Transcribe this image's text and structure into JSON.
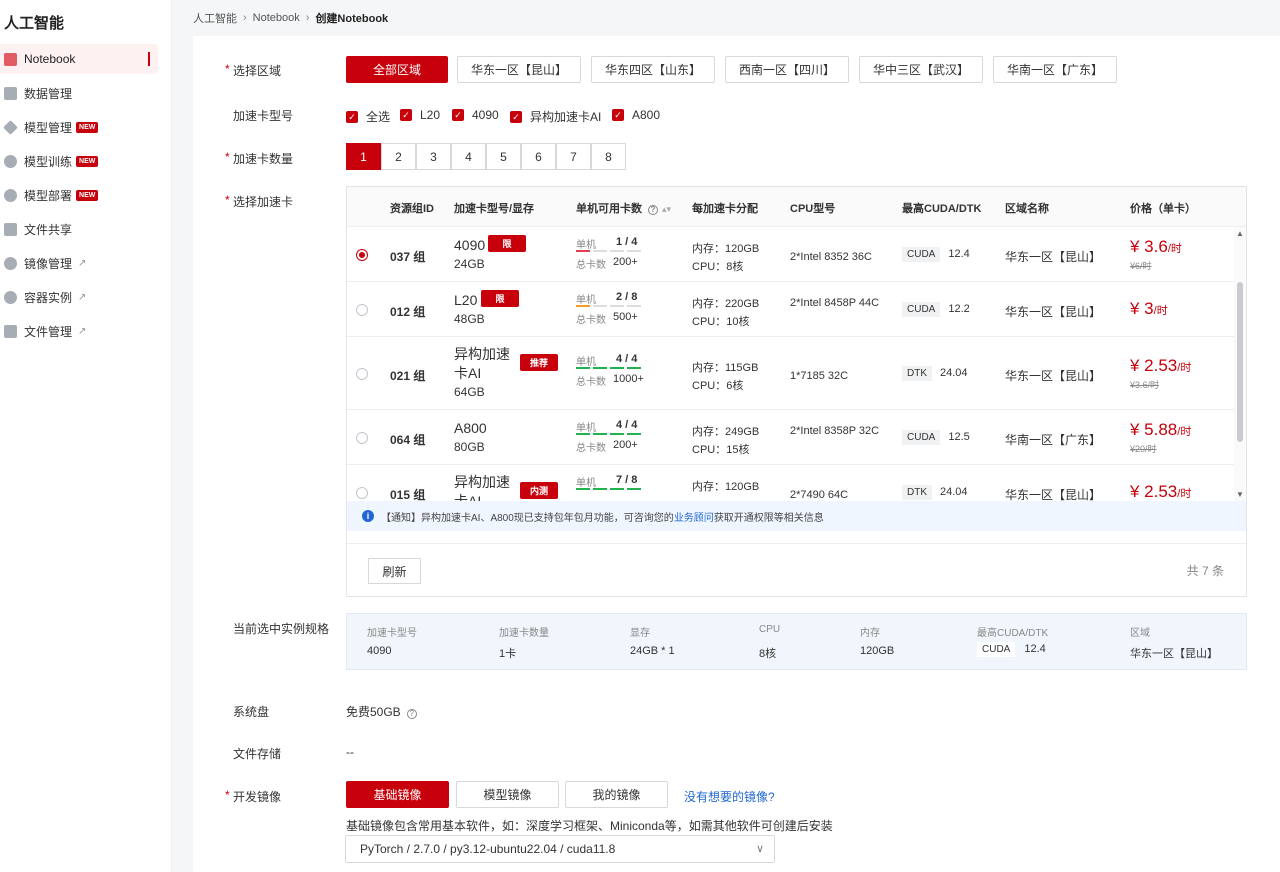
{
  "sidebar": {
    "title": "人工智能",
    "items": [
      {
        "label": "Notebook",
        "active": true,
        "icon": "notebook-icon"
      },
      {
        "label": "数据管理",
        "icon": "database-icon"
      },
      {
        "label": "模型管理",
        "badge": "NEW",
        "icon": "model-icon"
      },
      {
        "label": "模型训练",
        "badge": "NEW",
        "icon": "training-icon"
      },
      {
        "label": "模型部署",
        "badge": "NEW",
        "icon": "deploy-icon"
      },
      {
        "label": "文件共享",
        "icon": "file-share-icon"
      },
      {
        "label": "镜像管理",
        "external": true,
        "icon": "image-icon"
      },
      {
        "label": "容器实例",
        "external": true,
        "icon": "container-icon"
      },
      {
        "label": "文件管理",
        "external": true,
        "icon": "folder-icon"
      }
    ]
  },
  "breadcrumb": [
    "人工智能",
    "Notebook",
    "创建Notebook"
  ],
  "form": {
    "region": {
      "label": "选择区域",
      "options": [
        "全部区域",
        "华东一区【昆山】",
        "华东四区【山东】",
        "西南一区【四川】",
        "华中三区【武汉】",
        "华南一区【广东】"
      ],
      "selected": 0
    },
    "card_type": {
      "label": "加速卡型号",
      "options": [
        "全选",
        "L20",
        "4090",
        "异构加速卡AI",
        "A800"
      ]
    },
    "card_count": {
      "label": "加速卡数量",
      "options": [
        "1",
        "2",
        "3",
        "4",
        "5",
        "6",
        "7",
        "8"
      ],
      "selected": 0
    },
    "select_card": {
      "label": "选择加速卡"
    },
    "spec_label": "当前选中实例规格",
    "disk": {
      "label": "系统盘",
      "value": "免费50GB"
    },
    "storage": {
      "label": "文件存储",
      "value": "--"
    },
    "dev_image": {
      "label": "开发镜像",
      "tabs": [
        "基础镜像",
        "模型镜像",
        "我的镜像"
      ],
      "selected": 0,
      "link": "没有想要的镜像?",
      "desc": "基础镜像包含常用基本软件，如：深度学习框架、Miniconda等，如需其他软件可创建后安装",
      "select_value": "PyTorch / 2.7.0 / py3.12-ubuntu22.04 / cuda11.8"
    }
  },
  "table": {
    "headers": [
      "资源组ID",
      "加速卡型号/显存",
      "单机可用卡数",
      "每加速卡分配",
      "CPU型号",
      "最高CUDA/DTK",
      "区域名称",
      "价格（单卡）"
    ],
    "avail_labels": {
      "single": "单机",
      "total": "总卡数"
    },
    "rows": [
      {
        "id": "037 组",
        "gpu": "4090",
        "vram": "24GB",
        "tag": "限",
        "single": "1 / 4",
        "total": "200+",
        "mem": "内存：120GB",
        "cpu": "CPU：8核",
        "cpu_model": "2*Intel 8352 36C",
        "sdk": "CUDA",
        "sdk_ver": "12.4",
        "region": "华东一区【昆山】",
        "price": "¥ 3.6",
        "unit": "/时",
        "old": "¥6/时",
        "selected": true,
        "fill": 0.25,
        "bar": "#e04050"
      },
      {
        "id": "012 组",
        "gpu": "L20",
        "vram": "48GB",
        "tag": "限",
        "single": "2 / 8",
        "total": "500+",
        "mem": "内存：220GB",
        "cpu": "CPU：10核",
        "cpu_model": "2*Intel 8458P 44C",
        "sdk": "CUDA",
        "sdk_ver": "12.2",
        "region": "华东一区【昆山】",
        "price": "¥ 3",
        "unit": "/时",
        "old": "",
        "fill": 0.25,
        "bar": "#f0a020"
      },
      {
        "id": "021 组",
        "gpu": "异构加速卡AI",
        "vram": "64GB",
        "tag": "推荐",
        "single": "4 / 4",
        "total": "1000+",
        "mem": "内存：115GB",
        "cpu": "CPU：6核",
        "cpu_model": "1*7185 32C",
        "sdk": "DTK",
        "sdk_ver": "24.04",
        "region": "华东一区【昆山】",
        "price": "¥ 2.53",
        "unit": "/时",
        "old": "¥3.6/时",
        "fill": 1,
        "bar": "#22b14c"
      },
      {
        "id": "064 组",
        "gpu": "A800",
        "vram": "80GB",
        "tag": "",
        "single": "4 / 4",
        "total": "200+",
        "mem": "内存：249GB",
        "cpu": "CPU：15核",
        "cpu_model": "2*Intel 8358P 32C",
        "sdk": "CUDA",
        "sdk_ver": "12.5",
        "region": "华南一区【广东】",
        "price": "¥ 5.88",
        "unit": "/时",
        "old": "¥20/时",
        "fill": 1,
        "bar": "#22b14c"
      },
      {
        "id": "015 组",
        "gpu": "异构加速卡AI",
        "vram": "",
        "tag": "内测",
        "single": "7 / 8",
        "total": "",
        "mem": "内存：120GB",
        "cpu": "",
        "cpu_model": "2*7490 64C",
        "sdk": "DTK",
        "sdk_ver": "24.04",
        "region": "华东一区【昆山】",
        "price": "¥ 2.53",
        "unit": "/时",
        "old": "",
        "fill": 0.875,
        "bar": "#22b14c"
      }
    ],
    "notice_prefix": "【通知】异构加速卡AI、A800现已支持包年包月功能，可咨询您的",
    "notice_link": "业务顾问",
    "notice_suffix": "获取开通权限等相关信息",
    "refresh": "刷新",
    "total": "共 7 条"
  },
  "spec": {
    "keys": [
      "加速卡型号",
      "加速卡数量",
      "显存",
      "CPU",
      "内存",
      "最高CUDA/DTK",
      "区域"
    ],
    "vals": [
      "4090",
      "1卡",
      "24GB * 1",
      "8核",
      "120GB",
      "12.4",
      "华东一区【昆山】"
    ],
    "sdk": "CUDA"
  },
  "colors": {
    "accent": "#c7000b",
    "link": "#2067d3"
  }
}
